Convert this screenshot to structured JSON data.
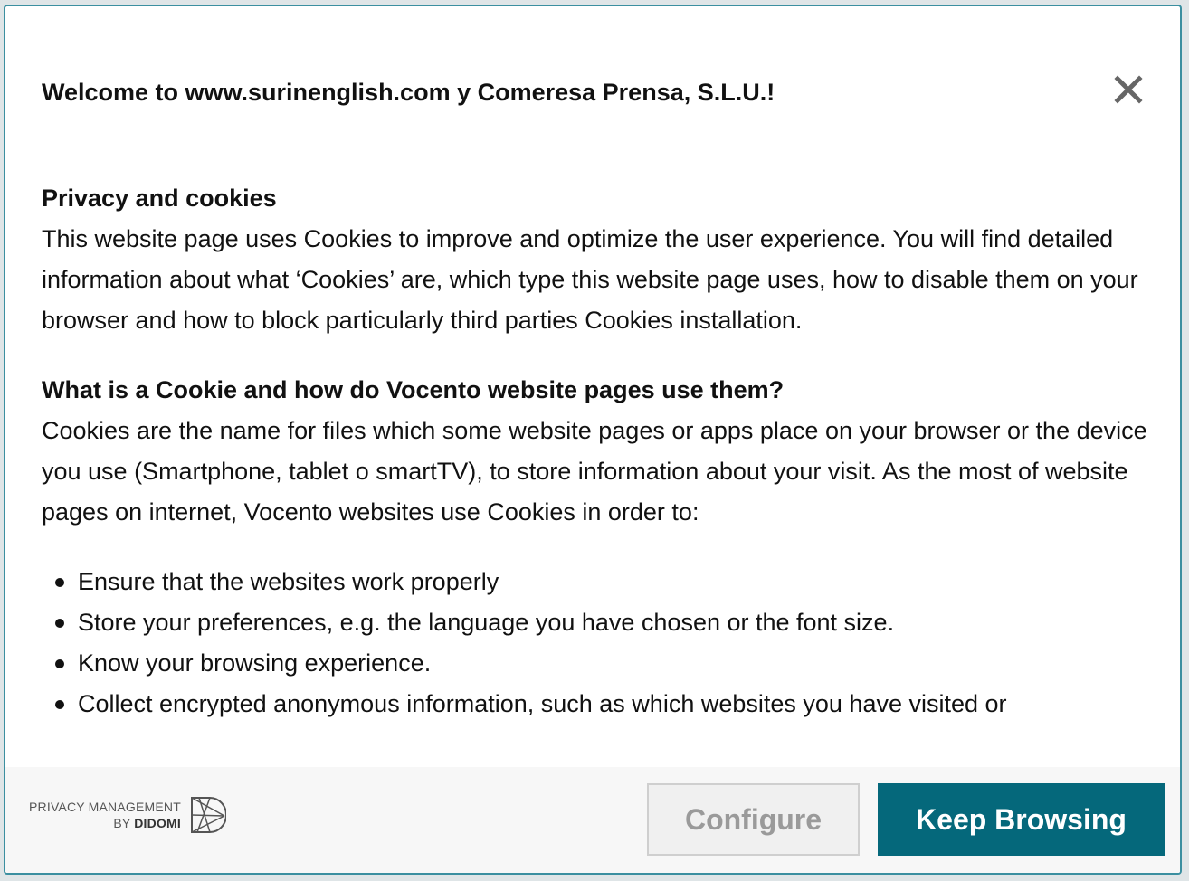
{
  "dialog": {
    "title": "Welcome to www.surinenglish.com y Comeresa Prensa, S.L.U.!",
    "close_icon": "close-icon"
  },
  "body": {
    "section1": {
      "heading": "Privacy and cookies",
      "text": "This website page uses Cookies to improve and optimize the user experience. You will find detailed information about what ‘Cookies’ are, which type this website page uses, how to disable them on your browser and how to block particularly third parties Cookies installation."
    },
    "section2": {
      "heading": "What is a Cookie and how do Vocento website pages use them?",
      "text": "Cookies are the name for files which some website pages or apps place on your browser or the device you use (Smartphone, tablet o smartTV), to store information about your visit. As the most of website pages on internet, Vocento websites use Cookies in order to:"
    },
    "bullets": [
      "Ensure that the websites work properly",
      "Store your preferences, e.g. the language you have chosen or the font size.",
      "Know your browsing experience.",
      "Collect encrypted anonymous information, such as which websites you have visited or"
    ]
  },
  "footer": {
    "brand_line1": "PRIVACY MANAGEMENT",
    "brand_by": "BY",
    "brand_name": "DIDOMI",
    "brand_icon": "didomi-logo-icon",
    "configure_label": "Configure",
    "keep_browsing_label": "Keep Browsing"
  },
  "colors": {
    "accent": "#05687b",
    "border": "#3b8fa0"
  }
}
